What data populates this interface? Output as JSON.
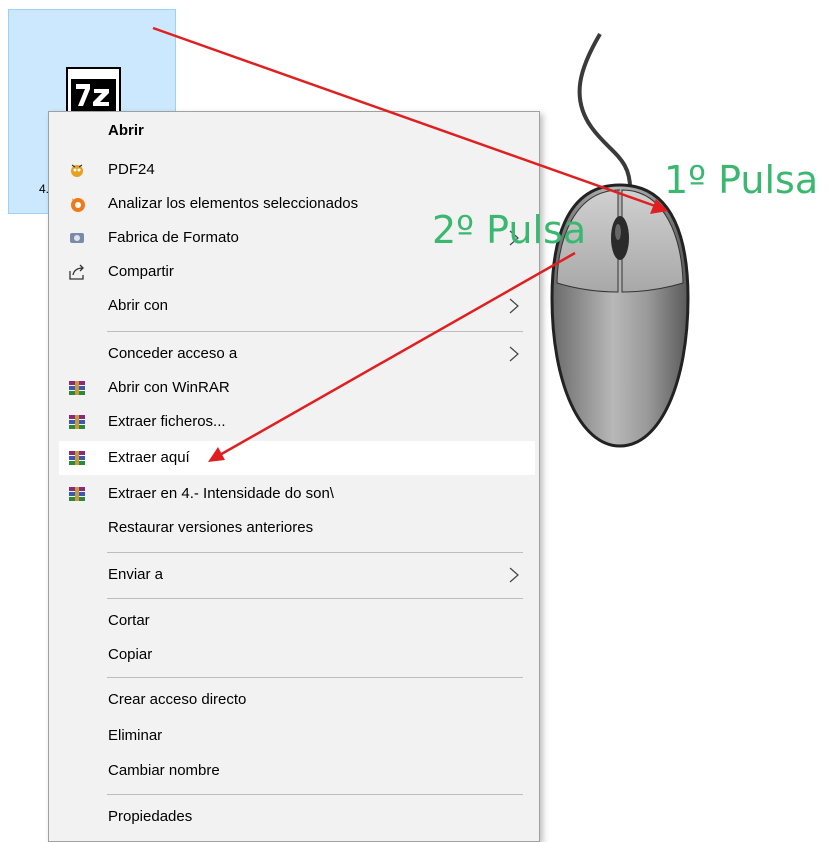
{
  "file": {
    "label": "4.-",
    "icon": "7z-archive-icon"
  },
  "menu": {
    "items": [
      {
        "label": "Abrir",
        "icon": "",
        "bold": true,
        "submenu": false
      },
      {
        "label": "PDF24",
        "icon": "pdf24-icon",
        "submenu": false
      },
      {
        "label": "Analizar los elementos seleccionados",
        "icon": "avast-icon",
        "submenu": false
      },
      {
        "label": "Fabrica de Formato",
        "icon": "format-factory-icon",
        "submenu": true
      },
      {
        "label": "Compartir",
        "icon": "share-icon",
        "submenu": false
      },
      {
        "label": "Abrir con",
        "icon": "",
        "submenu": true
      },
      {
        "label": "Conceder acceso a",
        "icon": "",
        "submenu": true
      },
      {
        "label": "Abrir con WinRAR",
        "icon": "winrar-icon",
        "submenu": false
      },
      {
        "label": "Extraer ficheros...",
        "icon": "winrar-icon",
        "submenu": false
      },
      {
        "label": "Extraer aquí",
        "icon": "winrar-icon",
        "submenu": false,
        "highlighted": true
      },
      {
        "label": "Extraer en 4.- Intensidade do son\\",
        "icon": "winrar-icon",
        "submenu": false
      },
      {
        "label": "Restaurar versiones anteriores",
        "icon": "",
        "submenu": false
      },
      {
        "label": "Enviar a",
        "icon": "",
        "submenu": true
      },
      {
        "label": "Cortar",
        "icon": "",
        "submenu": false
      },
      {
        "label": "Copiar",
        "icon": "",
        "submenu": false
      },
      {
        "label": "Crear acceso directo",
        "icon": "",
        "submenu": false
      },
      {
        "label": "Eliminar",
        "icon": "",
        "submenu": false
      },
      {
        "label": "Cambiar nombre",
        "icon": "",
        "submenu": false
      },
      {
        "label": "Propiedades",
        "icon": "",
        "submenu": false
      }
    ]
  },
  "annotations": {
    "pulsa_1": "1º Pulsa",
    "pulsa_2": "2º Pulsa",
    "label_color": "#3ab870",
    "arrow_color": "#e02020"
  },
  "colors": {
    "selection_bg": "#cce8ff",
    "menu_bg": "#f2f2f2",
    "highlight_bg": "#ffffff"
  }
}
